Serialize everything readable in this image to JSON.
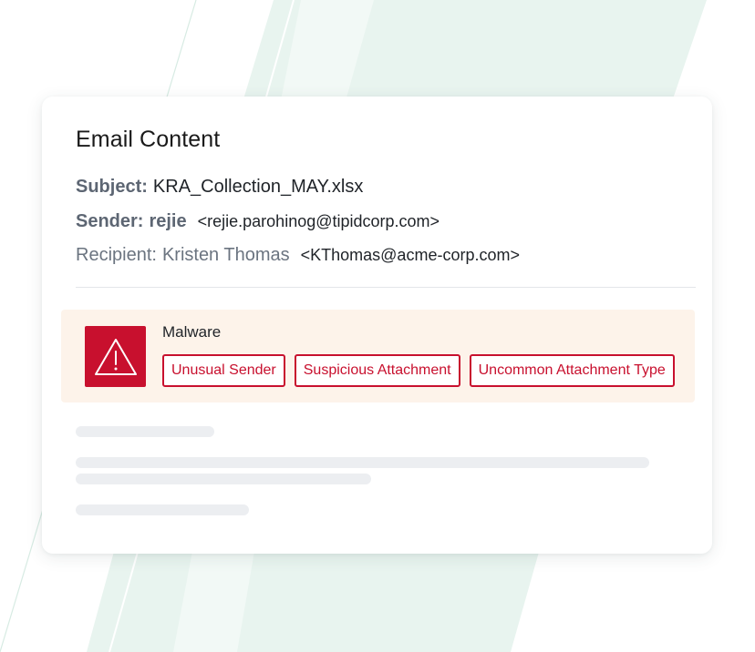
{
  "card": {
    "title": "Email Content"
  },
  "email": {
    "subject_label": "Subject:",
    "subject_value": "KRA_Collection_MAY.xlsx",
    "sender_label": "Sender:",
    "sender_name": "rejie",
    "sender_email": "<rejie.parohinog@tipidcorp.com>",
    "recipient_label": "Recipient:",
    "recipient_name": "Kristen Thomas",
    "recipient_email": "<KThomas@acme-corp.com>"
  },
  "alert": {
    "title": "Malware",
    "icon": "warning-triangle-icon",
    "tags": [
      "Unusual Sender",
      "Suspicious Attachment",
      "Uncommon Attachment Type"
    ]
  },
  "colors": {
    "alert_red": "#c8102e",
    "alert_background": "#fdf3ea",
    "background_stripe": "#e8f4ef",
    "skeleton": "#eceef1"
  }
}
